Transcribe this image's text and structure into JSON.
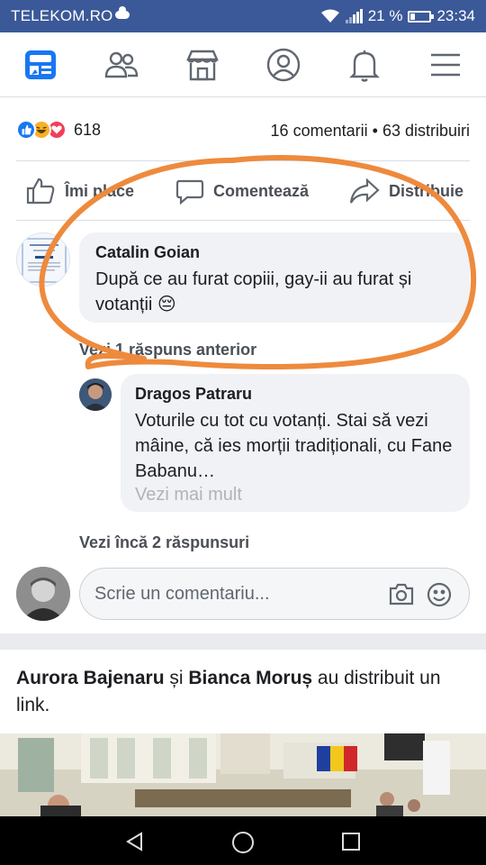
{
  "status_bar": {
    "carrier": "TELEKOM.RO",
    "battery": "21 %",
    "time": "23:34"
  },
  "nav": [
    "news-feed",
    "friends",
    "marketplace",
    "profile",
    "notifications",
    "menu"
  ],
  "post": {
    "reaction_count": "618",
    "comments": "16 comentarii",
    "separator": "•",
    "shares": "63 distribuiri",
    "actions": {
      "like": "Îmi place",
      "comment": "Comentează",
      "share": "Distribuie"
    }
  },
  "comments": [
    {
      "author": "Catalin Goian",
      "text": "După ce au furat copiii, gay-ii au furat și votanții 😔",
      "avatar_text": "Catalin Goian"
    },
    {
      "author": "Dragos Patraru",
      "text": "Voturile cu tot cu votanți. Stai să vezi mâine, că ies morții tradiționali, cu Fane Babanu…",
      "see_more": "Vezi mai mult"
    }
  ],
  "previous_reply": "Vezi 1 răspuns anterior",
  "more_replies": "Vezi încă 2 răspunsuri",
  "write_comment_placeholder": "Scrie un comentariu...",
  "shared": {
    "user1": "Aurora Bajenaru",
    "conj": " și ",
    "user2": "Bianca Moruș",
    "rest": " au distribuit un link."
  },
  "colors": {
    "fb_blue": "#3b5998",
    "like_blue": "#1877f2",
    "haha_yellow": "#f7b125",
    "love_red": "#f33e58",
    "annotation_orange": "#ee8a3c"
  }
}
